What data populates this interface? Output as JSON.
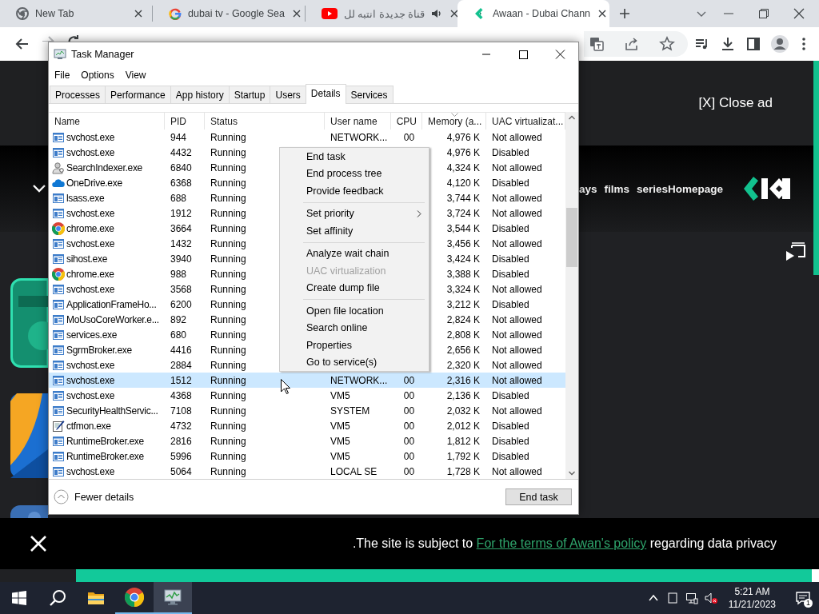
{
  "browser": {
    "tabs": [
      {
        "title": "New Tab",
        "kind": "chrome",
        "audio": false,
        "selected": false
      },
      {
        "title": "dubai tv - Google Sea",
        "kind": "google",
        "audio": false,
        "selected": false
      },
      {
        "title": "قناة جديدة انتبه لل",
        "kind": "youtube",
        "audio": true,
        "selected": false
      },
      {
        "title": "Awaan - Dubai Chann",
        "kind": "awaan",
        "audio": false,
        "selected": true
      }
    ]
  },
  "page": {
    "close_ad": "[X] Close ad",
    "nav": [
      "ays",
      "films",
      "seriesHomepage"
    ],
    "cookie": {
      "before": ".The site is subject to ",
      "link": "For the terms of Awan's policy",
      "after": " regarding data privacy"
    }
  },
  "task_manager": {
    "title": "Task Manager",
    "menu": [
      "File",
      "Options",
      "View"
    ],
    "tabs": [
      {
        "label": "Processes",
        "selected": false
      },
      {
        "label": "Performance",
        "selected": false
      },
      {
        "label": "App history",
        "selected": false
      },
      {
        "label": "Startup",
        "selected": false
      },
      {
        "label": "Users",
        "selected": false
      },
      {
        "label": "Details",
        "selected": true
      },
      {
        "label": "Services",
        "selected": false
      }
    ],
    "columns": [
      {
        "label": "Name",
        "sorted": false
      },
      {
        "label": "PID",
        "sorted": false
      },
      {
        "label": "Status",
        "sorted": false
      },
      {
        "label": "User name",
        "sorted": false
      },
      {
        "label": "CPU",
        "sorted": false
      },
      {
        "label": "Memory (a...",
        "sorted": true
      },
      {
        "label": "UAC virtualizat...",
        "sorted": false
      }
    ],
    "rows": [
      {
        "kind": "service",
        "name": "svchost.exe",
        "pid": "944",
        "status": "Running",
        "user": "NETWORK...",
        "cpu": "00",
        "memory": "4,976 K",
        "uac": "Not allowed",
        "selected": false
      },
      {
        "kind": "service",
        "name": "svchost.exe",
        "pid": "4432",
        "status": "Running",
        "memory": "4,976 K",
        "uac": "Disabled",
        "selected": false
      },
      {
        "kind": "person",
        "name": "SearchIndexer.exe",
        "pid": "6840",
        "status": "Running",
        "memory": "4,324 K",
        "uac": "Not allowed",
        "selected": false
      },
      {
        "kind": "cloud",
        "name": "OneDrive.exe",
        "pid": "6368",
        "status": "Running",
        "memory": "4,120 K",
        "uac": "Disabled",
        "selected": false
      },
      {
        "kind": "service",
        "name": "lsass.exe",
        "pid": "688",
        "status": "Running",
        "memory": "3,744 K",
        "uac": "Not allowed",
        "selected": false
      },
      {
        "kind": "service",
        "name": "svchost.exe",
        "pid": "1912",
        "status": "Running",
        "memory": "3,724 K",
        "uac": "Not allowed",
        "selected": false
      },
      {
        "kind": "chrome",
        "name": "chrome.exe",
        "pid": "3664",
        "status": "Running",
        "memory": "3,544 K",
        "uac": "Disabled",
        "selected": false
      },
      {
        "kind": "service",
        "name": "svchost.exe",
        "pid": "1432",
        "status": "Running",
        "memory": "3,456 K",
        "uac": "Not allowed",
        "selected": false
      },
      {
        "kind": "service",
        "name": "sihost.exe",
        "pid": "3940",
        "status": "Running",
        "memory": "3,424 K",
        "uac": "Disabled",
        "selected": false
      },
      {
        "kind": "chrome",
        "name": "chrome.exe",
        "pid": "988",
        "status": "Running",
        "memory": "3,388 K",
        "uac": "Disabled",
        "selected": false
      },
      {
        "kind": "service",
        "name": "svchost.exe",
        "pid": "3568",
        "status": "Running",
        "memory": "3,324 K",
        "uac": "Not allowed",
        "selected": false
      },
      {
        "kind": "service",
        "name": "ApplicationFrameHo...",
        "pid": "6200",
        "status": "Running",
        "memory": "3,212 K",
        "uac": "Disabled",
        "selected": false
      },
      {
        "kind": "service",
        "name": "MoUsoCoreWorker.e...",
        "pid": "892",
        "status": "Running",
        "memory": "2,824 K",
        "uac": "Not allowed",
        "selected": false
      },
      {
        "kind": "service",
        "name": "services.exe",
        "pid": "680",
        "status": "Running",
        "memory": "2,808 K",
        "uac": "Not allowed",
        "selected": false
      },
      {
        "kind": "service",
        "name": "SgrmBroker.exe",
        "pid": "4416",
        "status": "Running",
        "memory": "2,656 K",
        "uac": "Not allowed",
        "selected": false
      },
      {
        "kind": "service",
        "name": "svchost.exe",
        "pid": "2884",
        "status": "Running",
        "memory": "2,320 K",
        "uac": "Not allowed",
        "selected": false
      },
      {
        "kind": "service",
        "name": "svchost.exe",
        "pid": "1512",
        "status": "Running",
        "user": "NETWORK...",
        "cpu": "00",
        "memory": "2,316 K",
        "uac": "Not allowed",
        "selected": true
      },
      {
        "kind": "service",
        "name": "svchost.exe",
        "pid": "4368",
        "status": "Running",
        "user": "VM5",
        "cpu": "00",
        "memory": "2,136 K",
        "uac": "Disabled",
        "selected": false
      },
      {
        "kind": "service",
        "name": "SecurityHealthServic...",
        "pid": "7108",
        "status": "Running",
        "user": "SYSTEM",
        "cpu": "00",
        "memory": "2,032 K",
        "uac": "Not allowed",
        "selected": false
      },
      {
        "kind": "pen",
        "name": "ctfmon.exe",
        "pid": "4732",
        "status": "Running",
        "user": "VM5",
        "cpu": "00",
        "memory": "2,012 K",
        "uac": "Disabled",
        "selected": false
      },
      {
        "kind": "service",
        "name": "RuntimeBroker.exe",
        "pid": "2816",
        "status": "Running",
        "user": "VM5",
        "cpu": "00",
        "memory": "1,812 K",
        "uac": "Disabled",
        "selected": false
      },
      {
        "kind": "service",
        "name": "RuntimeBroker.exe",
        "pid": "5996",
        "status": "Running",
        "user": "VM5",
        "cpu": "00",
        "memory": "1,792 K",
        "uac": "Disabled",
        "selected": false
      },
      {
        "kind": "service",
        "name": "svchost.exe",
        "pid": "5064",
        "status": "Running",
        "user": "LOCAL SE",
        "cpu": "00",
        "memory": "1,728 K",
        "uac": "Not allowed",
        "selected": false
      }
    ],
    "fewer_details": "Fewer details",
    "end_task": "End task"
  },
  "context_menu": {
    "items": [
      {
        "kind": "item",
        "label": "End task",
        "disabled": false,
        "submenu": false
      },
      {
        "kind": "item",
        "label": "End process tree",
        "disabled": false,
        "submenu": false
      },
      {
        "kind": "item",
        "label": "Provide feedback",
        "disabled": false,
        "submenu": false
      },
      {
        "kind": "separator"
      },
      {
        "kind": "item",
        "label": "Set priority",
        "disabled": false,
        "submenu": true
      },
      {
        "kind": "item",
        "label": "Set affinity",
        "disabled": false,
        "submenu": false
      },
      {
        "kind": "separator"
      },
      {
        "kind": "item",
        "label": "Analyze wait chain",
        "disabled": false,
        "submenu": false
      },
      {
        "kind": "item",
        "label": "UAC virtualization",
        "disabled": true,
        "submenu": false
      },
      {
        "kind": "item",
        "label": "Create dump file",
        "disabled": false,
        "submenu": false
      },
      {
        "kind": "separator"
      },
      {
        "kind": "item",
        "label": "Open file location",
        "disabled": false,
        "submenu": false
      },
      {
        "kind": "item",
        "label": "Search online",
        "disabled": false,
        "submenu": false
      },
      {
        "kind": "item",
        "label": "Properties",
        "disabled": false,
        "submenu": false
      },
      {
        "kind": "item",
        "label": "Go to service(s)",
        "disabled": false,
        "submenu": false
      }
    ]
  },
  "taskbar": {
    "apps": [
      {
        "kind": "explorer",
        "running": false,
        "selected": false
      },
      {
        "kind": "chrome",
        "running": true,
        "selected": false
      },
      {
        "kind": "taskmgr",
        "running": true,
        "selected": true
      }
    ],
    "time": "5:21 AM",
    "date": "11/21/2023",
    "notifications": "1"
  }
}
